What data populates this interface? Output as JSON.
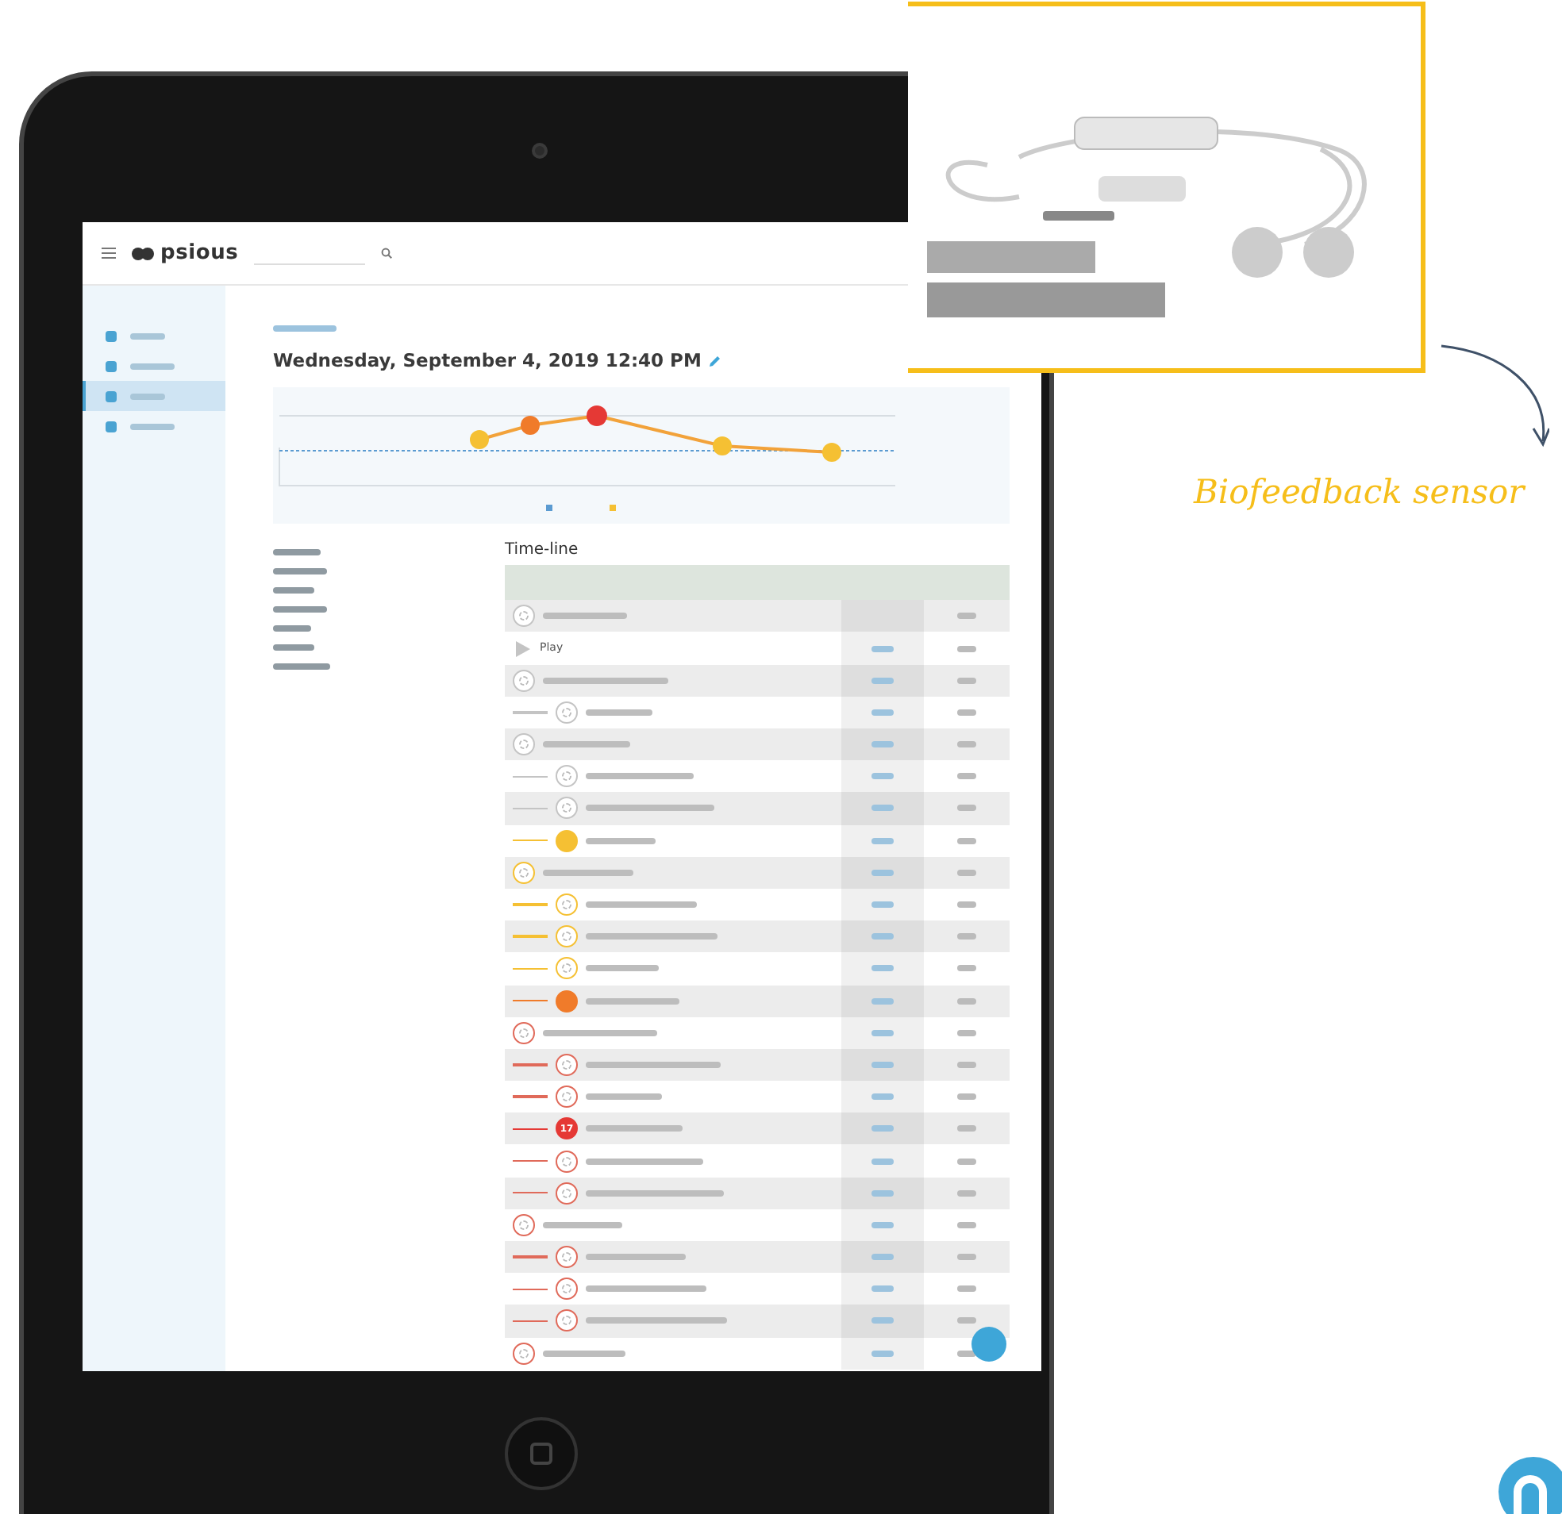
{
  "app": {
    "logo": "psious",
    "sidebar": {
      "items": [
        {
          "selected": false
        },
        {
          "selected": false
        },
        {
          "selected": true
        },
        {
          "selected": false
        }
      ]
    },
    "title": "Wednesday, September 4, 2019 12:40 PM",
    "timeline": {
      "title": "Time-line",
      "rows": [
        {
          "kind": "step",
          "color": "#c4c4c4",
          "filled": false
        },
        {
          "kind": "play",
          "label": "Play",
          "color": "#c4c4c4"
        },
        {
          "kind": "step",
          "color": "#c4c4c4",
          "filled": false,
          "children": [
            {
              "kind": "step",
              "color": "#c4c4c4",
              "filled": false
            }
          ]
        },
        {
          "kind": "step",
          "color": "#c4c4c4",
          "filled": false,
          "children": [
            {
              "kind": "step",
              "color": "#c4c4c4",
              "filled": false
            },
            {
              "kind": "step",
              "color": "#c4c4c4",
              "filled": false
            },
            {
              "kind": "step",
              "color": "#f5c033",
              "filled": true
            }
          ]
        },
        {
          "kind": "step",
          "color": "#f5c033",
          "filled": false,
          "children": [
            {
              "kind": "step",
              "color": "#f5c033",
              "filled": false
            },
            {
              "kind": "step",
              "color": "#f5c033",
              "filled": false
            },
            {
              "kind": "step",
              "color": "#f5c033",
              "filled": false
            },
            {
              "kind": "step",
              "color": "#f07b2a",
              "filled": true
            }
          ]
        },
        {
          "kind": "step",
          "color": "#e06a5a",
          "filled": false,
          "children": [
            {
              "kind": "step",
              "color": "#e06a5a",
              "filled": false
            },
            {
              "kind": "step",
              "color": "#e06a5a",
              "filled": false
            },
            {
              "kind": "step",
              "color": "#e53935",
              "filled": true,
              "badge": "17"
            },
            {
              "kind": "step",
              "color": "#e06a5a",
              "filled": false
            },
            {
              "kind": "step",
              "color": "#e06a5a",
              "filled": false
            }
          ]
        },
        {
          "kind": "step",
          "color": "#e06a5a",
          "filled": false,
          "children": [
            {
              "kind": "step",
              "color": "#e06a5a",
              "filled": false
            },
            {
              "kind": "step",
              "color": "#e06a5a",
              "filled": false
            },
            {
              "kind": "step",
              "color": "#e06a5a",
              "filled": false
            }
          ]
        },
        {
          "kind": "step",
          "color": "#e06a5a",
          "filled": false
        }
      ]
    }
  },
  "caption": "Biofeedback sensor"
}
